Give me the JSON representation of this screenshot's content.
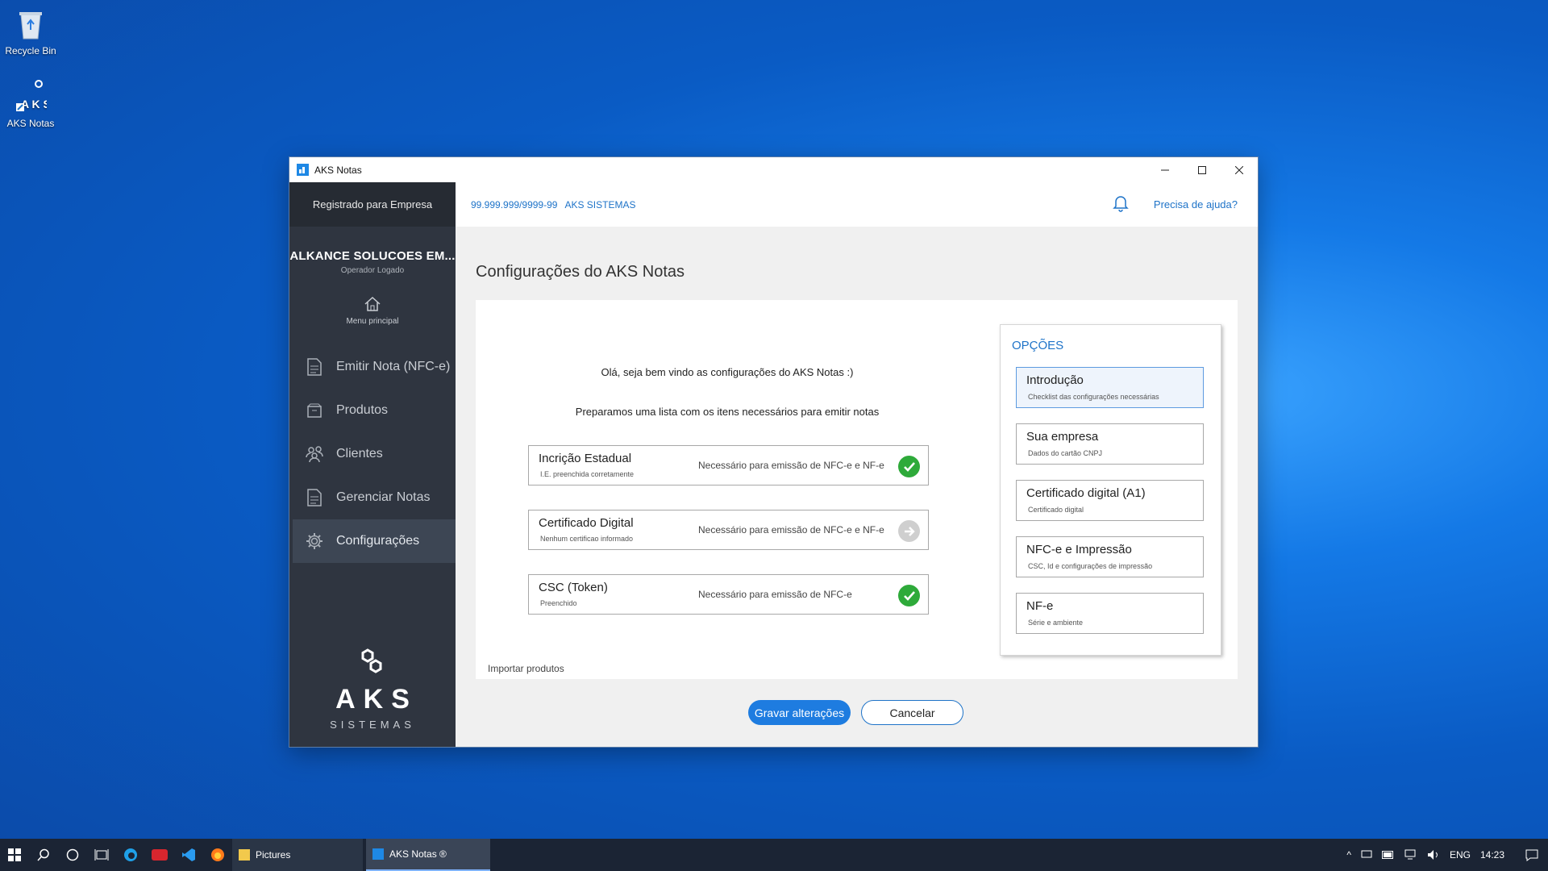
{
  "desktop": {
    "icons": [
      {
        "label": "Recycle Bin"
      },
      {
        "label": "AKS Notas"
      }
    ]
  },
  "window": {
    "title": "AKS Notas"
  },
  "sidebar": {
    "registered": "Registrado para Empresa",
    "company_name": "ALKANCE SOLUCOES EM...",
    "operator": "Operador Logado",
    "home_label": "Menu principal",
    "items": [
      {
        "label": "Emitir Nota (NFC-e)",
        "icon": "document-icon"
      },
      {
        "label": "Produtos",
        "icon": "box-icon"
      },
      {
        "label": "Clientes",
        "icon": "users-icon"
      },
      {
        "label": "Gerenciar Notas",
        "icon": "notes-icon"
      },
      {
        "label": "Configurações",
        "icon": "gear-icon",
        "active": true
      }
    ],
    "logo_text": "AKS",
    "logo_sub": "SISTEMAS"
  },
  "topbar": {
    "cnpj": "99.999.999/9999-99",
    "company": "AKS SISTEMAS",
    "help": "Precisa de ajuda?"
  },
  "main": {
    "title": "Configurações do AKS Notas",
    "welcome": "Olá, seja bem vindo as configurações do AKS Notas  :)",
    "prepared": "Preparamos uma lista com os itens necessários para emitir notas",
    "checklist": [
      {
        "title": "Incrição Estadual",
        "sub": "I.E. preenchida corretamente",
        "note": "Necessário para emissão de NFC-e e NF-e",
        "status": "ok"
      },
      {
        "title": "Certificado Digital",
        "sub": "Nenhum certificao informado",
        "note": "Necessário para emissão de NFC-e e NF-e",
        "status": "pending"
      },
      {
        "title": "CSC (Token)",
        "sub": "Preenchido",
        "note": "Necessário para emissão de NFC-e",
        "status": "ok"
      }
    ],
    "import_link": "Importar produtos"
  },
  "options": {
    "header": "OPÇÕES",
    "items": [
      {
        "title": "Introdução",
        "sub": "Checklist das configurações necessárias",
        "selected": true
      },
      {
        "title": "Sua empresa",
        "sub": "Dados do cartão CNPJ"
      },
      {
        "title": "Certificado digital (A1)",
        "sub": "Certificado digital"
      },
      {
        "title": "NFC-e e Impressão",
        "sub": "CSC, Id e configurações de impressão"
      },
      {
        "title": "NF-e",
        "sub": "Série e ambiente"
      }
    ]
  },
  "buttons": {
    "save": "Gravar alterações",
    "cancel": "Cancelar"
  },
  "taskbar": {
    "apps": [
      {
        "label": "Pictures"
      },
      {
        "label": "AKS Notas ®"
      }
    ],
    "lang": "ENG",
    "time": "14:23"
  },
  "colors": {
    "accent": "#1e7ce0",
    "sidebar": "#2f3540",
    "ok": "#2eaa3a"
  }
}
